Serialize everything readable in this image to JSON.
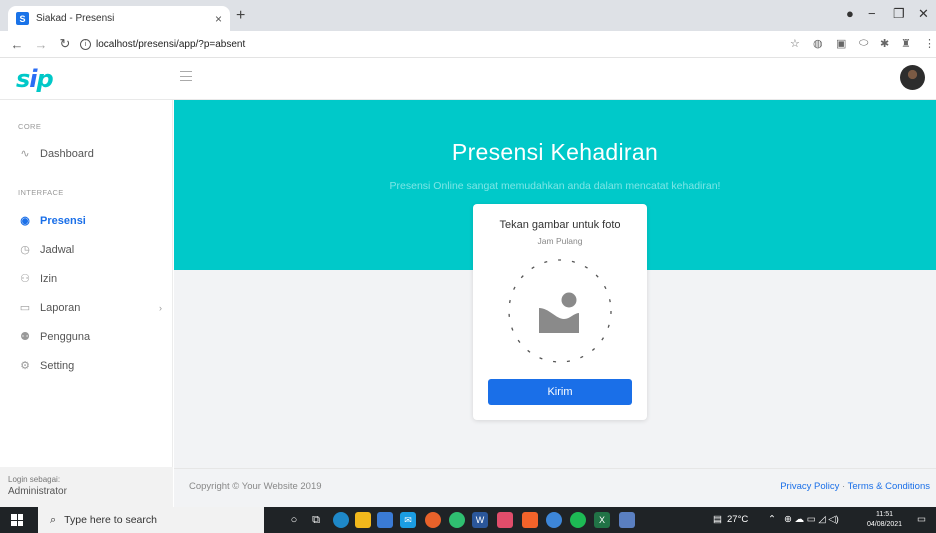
{
  "browser": {
    "tab_title": "Siakad - Presensi",
    "favicon_letter": "S",
    "tab_close": "×",
    "new_tab": "+",
    "url": "localhost/presensi/app/?p=absent"
  },
  "app": {
    "logo_text_1": "s",
    "logo_text_2": "i",
    "logo_text_3": "p"
  },
  "sidebar": {
    "core_heading": "CORE",
    "interface_heading": "INTERFACE",
    "items": [
      {
        "label": "Dashboard",
        "icon": "activity-icon"
      },
      {
        "label": "Presensi",
        "icon": "fingerprint-icon",
        "active": true
      },
      {
        "label": "Jadwal",
        "icon": "clock-icon"
      },
      {
        "label": "Izin",
        "icon": "user-plus-icon"
      },
      {
        "label": "Laporan",
        "icon": "clipboard-icon",
        "chevron": "›"
      },
      {
        "label": "Pengguna",
        "icon": "users-icon"
      },
      {
        "label": "Setting",
        "icon": "gear-icon"
      }
    ],
    "footer_label": "Login sebagai:",
    "footer_user": "Administrator"
  },
  "hero": {
    "title": "Presensi Kehadiran",
    "subtitle": "Presensi Online sangat memudahkan anda dalam mencatat kehadiran!"
  },
  "card": {
    "title": "Tekan gambar untuk foto",
    "subtitle": "Jam Pulang",
    "submit_label": "Kirim"
  },
  "footer": {
    "copyright": "Copyright © Your Website 2019",
    "privacy": "Privacy Policy",
    "separator": "·",
    "terms": "Terms & Conditions"
  },
  "taskbar": {
    "search_placeholder": "Type here to search",
    "weather": "27°C",
    "time": "11:51",
    "date": "04/08/2021"
  },
  "colors": {
    "accent": "#00c9c9",
    "primary": "#1a6fe8",
    "page_bg": "#f2f3f5"
  }
}
